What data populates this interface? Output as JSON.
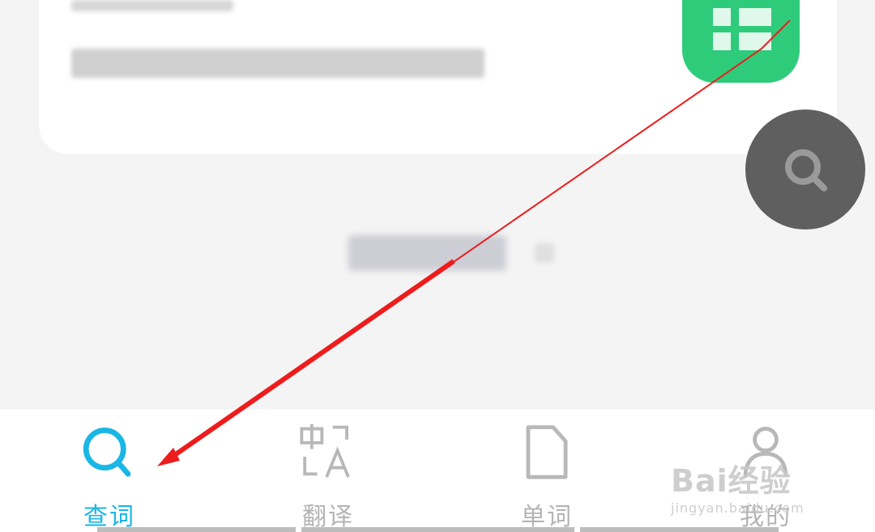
{
  "tabs": [
    {
      "label": "查词",
      "icon": "search-icon",
      "active": true
    },
    {
      "label": "翻译",
      "icon": "translate-icon",
      "active": false
    },
    {
      "label": "单词",
      "icon": "document-icon",
      "active": false
    },
    {
      "label": "我的",
      "icon": "user-icon",
      "active": false
    }
  ],
  "watermark": {
    "line1": "Bai经验",
    "line2": "jingyan.baidu.com"
  },
  "colors": {
    "accent": "#19b6e6",
    "green": "#2ecc7a",
    "arrow": "#ee1c1c",
    "inactive": "#b4b4b4"
  }
}
